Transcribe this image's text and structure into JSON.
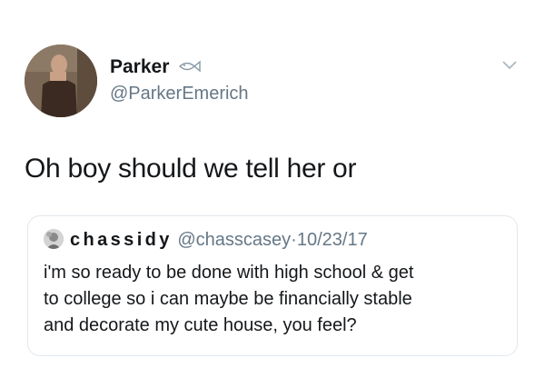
{
  "tweet": {
    "display_name": "Parker",
    "handle": "@ParkerEmerich",
    "text": "Oh boy should we tell her or",
    "icons": [
      "fish-emoji-icon",
      "chevron-down-icon"
    ]
  },
  "quoted_tweet": {
    "display_name": "chassidy",
    "handle": "@chasscasey",
    "separator": "·",
    "date": "10/23/17",
    "text_lines": [
      "i'm so ready to be done with high school & get",
      "to college so i can maybe be financially stable",
      "and decorate my cute house, you feel?"
    ]
  }
}
